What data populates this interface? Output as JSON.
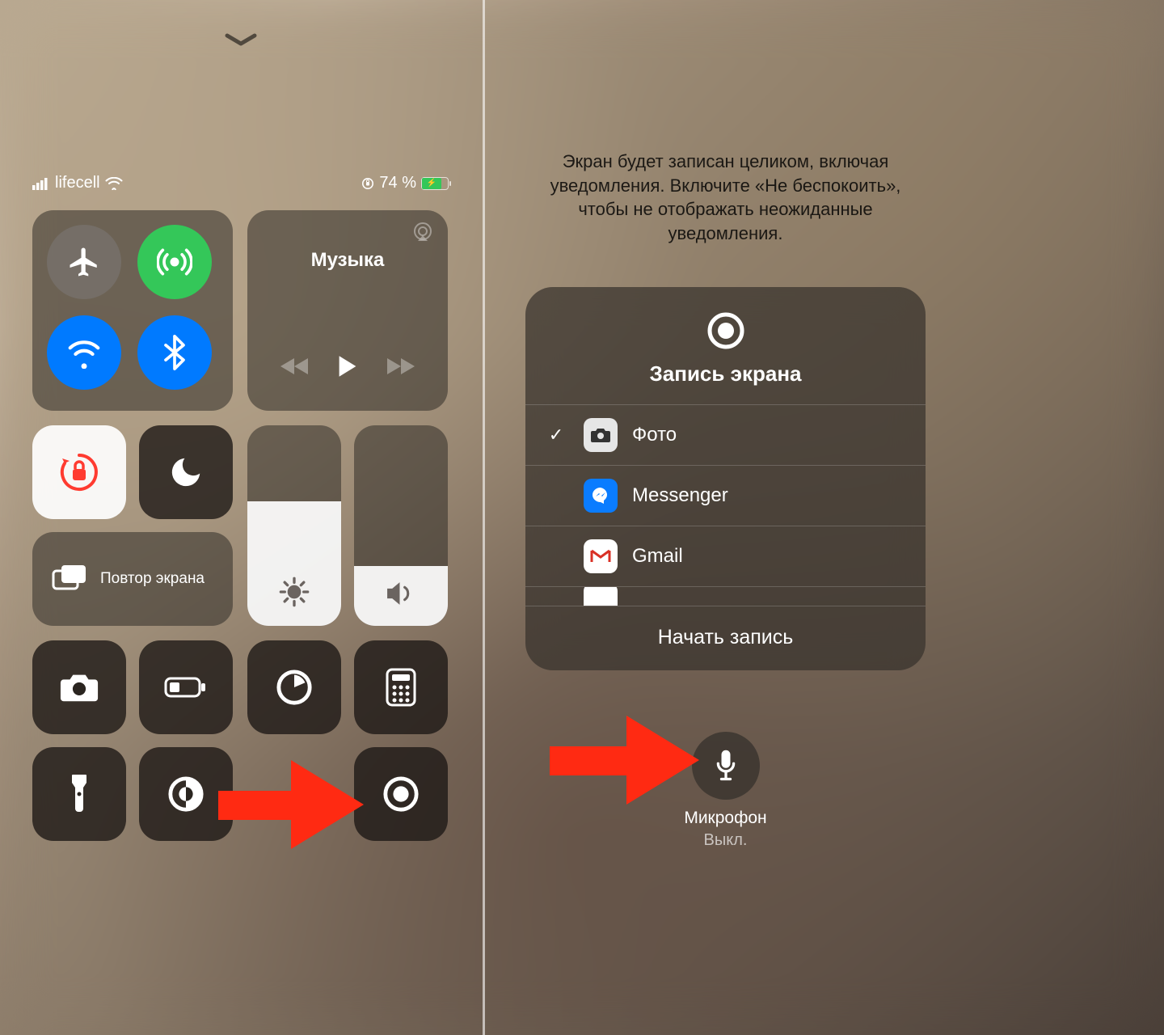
{
  "status": {
    "carrier": "lifecell",
    "battery_percent": "74 %"
  },
  "music": {
    "title": "Музыка"
  },
  "mirror": {
    "label": "Повтор экрана"
  },
  "sliders": {
    "brightness_pct": 62,
    "volume_pct": 30
  },
  "right": {
    "notice": "Экран будет записан целиком, включая уведомления. Включите «Не беспокоить», чтобы не отображать неожиданные уведомления.",
    "title": "Запись экрана",
    "apps": [
      {
        "name": "Фото",
        "selected": true,
        "icon": "camera",
        "bg": "#e6e6e6",
        "fg": "#333"
      },
      {
        "name": "Messenger",
        "selected": false,
        "icon": "messenger",
        "bg": "#0a7cff",
        "fg": "#fff"
      },
      {
        "name": "Gmail",
        "selected": false,
        "icon": "gmail",
        "bg": "#ffffff",
        "fg": "#d93025"
      }
    ],
    "start_label": "Начать запись",
    "mic_label": "Микрофон",
    "mic_state": "Выкл."
  }
}
